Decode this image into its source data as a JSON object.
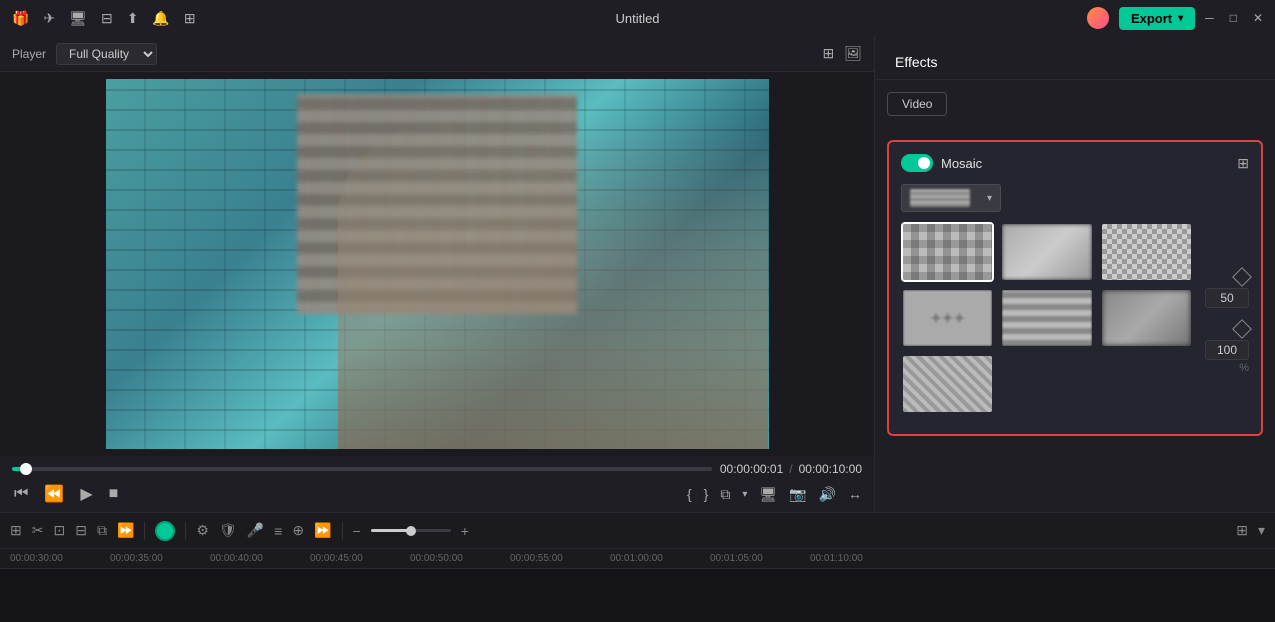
{
  "titlebar": {
    "title": "Untitled",
    "export_label": "Export"
  },
  "player": {
    "label": "Player",
    "quality": "Full Quality",
    "time_current": "00:00:00:01",
    "time_total": "00:00:10:00"
  },
  "effects": {
    "tab_label": "Effects",
    "video_tab": "Video",
    "mosaic": {
      "title": "Mosaic",
      "enabled": true,
      "value1": "50",
      "value2": "100",
      "pct_label": "%"
    }
  },
  "timeline": {
    "marks": [
      "00:00:30:00",
      "00:00:35:00",
      "00:00:40:00",
      "00:00:45:00",
      "00:00:50:00",
      "00:00:55:00",
      "00:01:00:00",
      "00:01:05:00",
      "00:01:10:00"
    ]
  },
  "icons": {
    "gift": "🎁",
    "send": "✈",
    "monitor": "🖥",
    "minus": "⊟",
    "upload": "⬆",
    "bell": "🔔",
    "grid": "⊞",
    "chevron_down": "▾",
    "minimize": "─",
    "maximize": "□",
    "close": "✕",
    "quad_view": "⊞",
    "image": "🖼",
    "back_skip": "⏮",
    "back_frame": "⏪",
    "play": "▶",
    "stop": "■",
    "bracket_open": "{",
    "bracket_close": "}",
    "crop": "⧉",
    "screen": "🖥",
    "camera": "📷",
    "audio": "🔊",
    "transform": "↔",
    "settings": "⚙"
  }
}
